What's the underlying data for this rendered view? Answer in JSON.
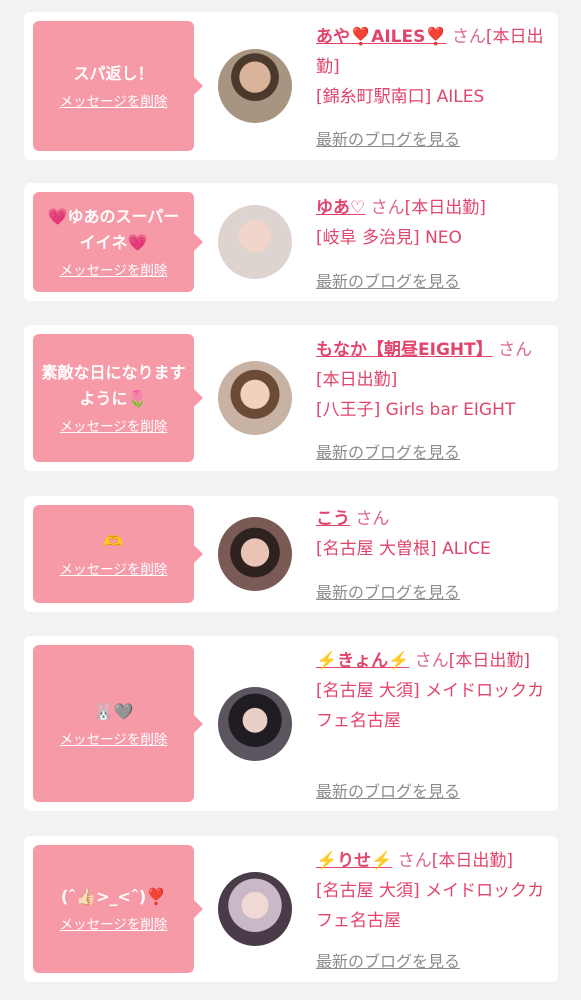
{
  "common": {
    "delete_label": "メッセージを削除",
    "blog_label": "最新のブログを見る",
    "san": "さん"
  },
  "items": [
    {
      "message": "スパ返し！",
      "name": "あや❣️AILES❣️",
      "status": "[本日出勤]",
      "shop": "[錦糸町駅南口] AILES"
    },
    {
      "message": "💗ゆあのスーパーイイネ💗",
      "name": "ゆあ♡",
      "status": "[本日出勤]",
      "shop": "[岐阜 多治見] NEO"
    },
    {
      "message": "素敵な日になりますように🌷",
      "name": "もなか【朝昼EIGHT】",
      "status": "[本日出勤]",
      "shop": "[八王子] Girls bar EIGHT"
    },
    {
      "message": "🫶",
      "name": "こう",
      "status": "",
      "shop": "[名古屋 大曽根] ALICE"
    },
    {
      "message": "🐰🩶",
      "name": "⚡️きょん⚡️",
      "status": "[本日出勤]",
      "shop": "[名古屋 大須] メイドロックカフェ名古屋"
    },
    {
      "message": "(ˆ👍🏻>_<ˆ)❣️",
      "name": "⚡️りせ⚡️",
      "status": "[本日出勤]",
      "shop": "[名古屋 大須] メイドロックカフェ名古屋"
    }
  ],
  "colors": {
    "bubble": "#f69aa8",
    "name": "#e2456b",
    "link_gray": "#8c8c8c",
    "background": "#f2f2f4"
  }
}
